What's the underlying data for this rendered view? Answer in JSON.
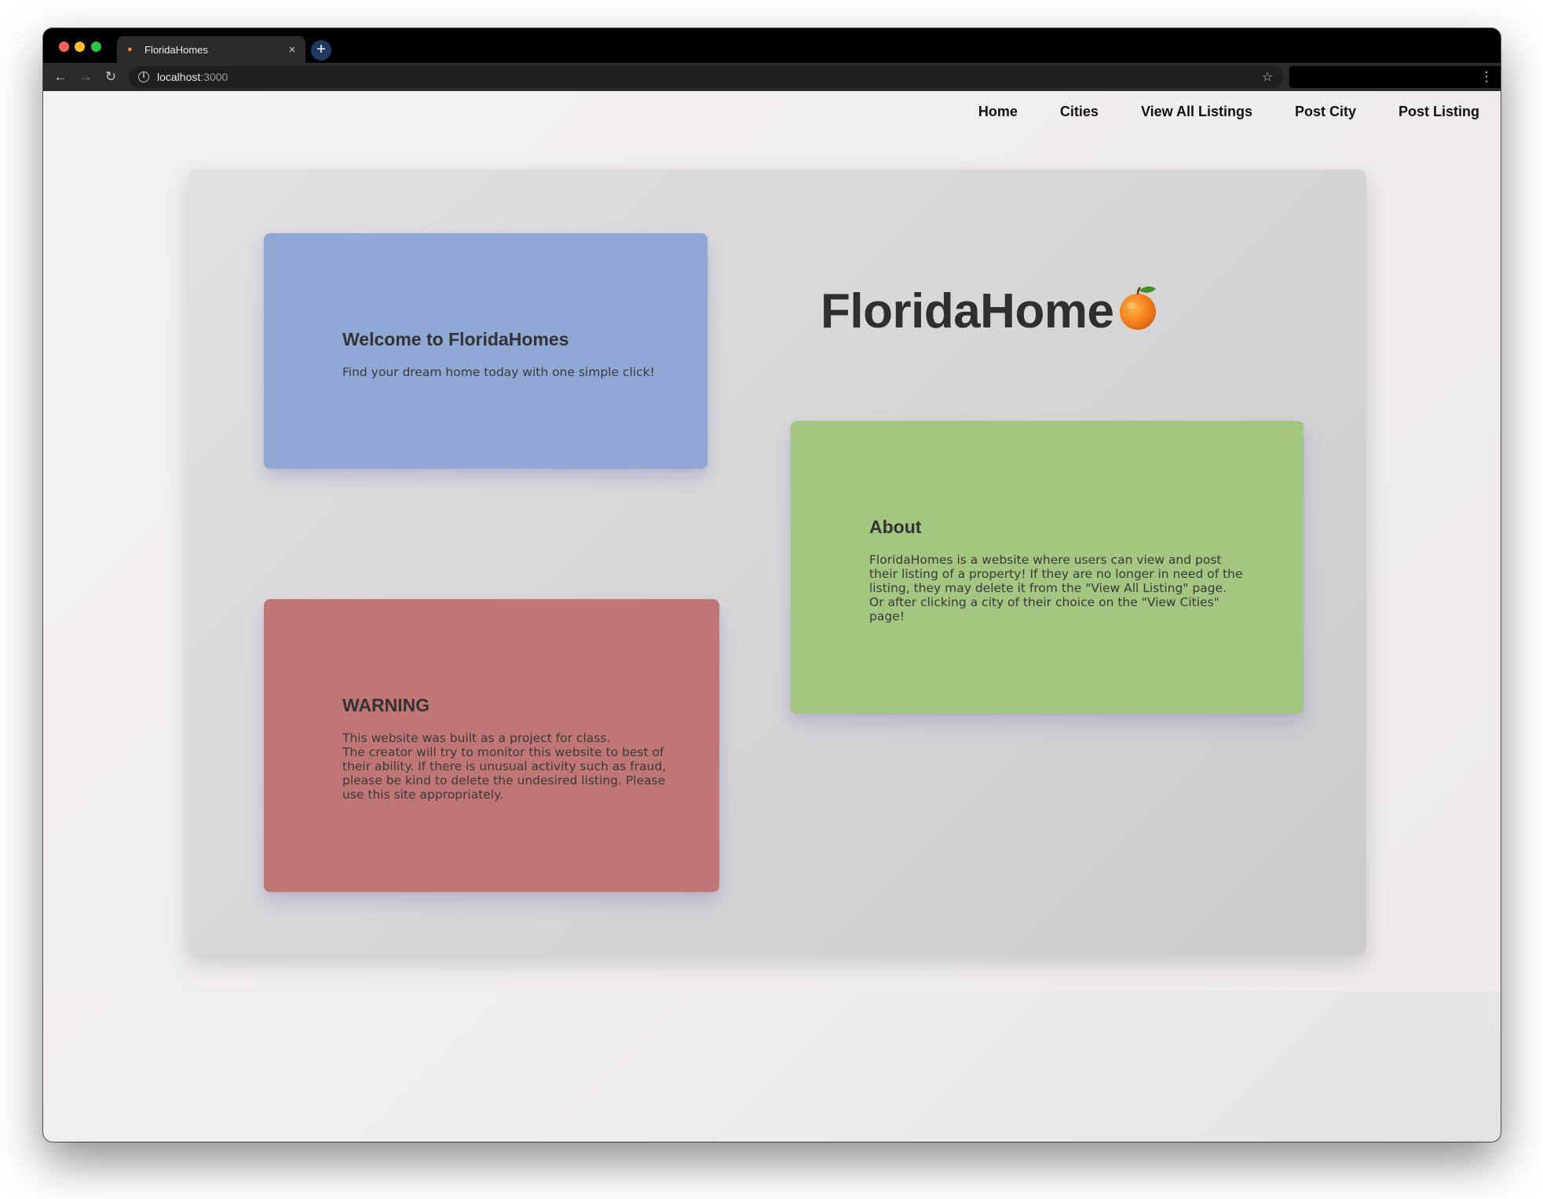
{
  "browser": {
    "tab_title": "FloridaHomes",
    "url_host": "localhost",
    "url_port": ":3000"
  },
  "nav": {
    "items": [
      {
        "label": "Home"
      },
      {
        "label": "Cities"
      },
      {
        "label": "View All Listings"
      },
      {
        "label": "Post City"
      },
      {
        "label": "Post Listing"
      }
    ]
  },
  "logo": {
    "text": "FloridaHome",
    "icon": "orange-emoji"
  },
  "welcome": {
    "title": "Welcome to FloridaHomes",
    "body": "Find your dream home today with one simple click!"
  },
  "about": {
    "title": "About",
    "body": "FloridaHomes is a website where users can view and post their listing of a property! If they are no longer in need of the listing, they may delete it from the \"View All Listing\" page.\nOr after clicking a city of their choice on the \"View Cities\" page!"
  },
  "warning": {
    "title": "WARNING",
    "body": "This website was built as a project for class.\nThe creator will try to monitor this website to best of their ability. If there is unusual activity such as fraud, please be kind to delete the undesired listing. Please use this site appropriately."
  },
  "colors": {
    "welcome_card": "#8fa8d5",
    "about_card": "#a3c681",
    "warning_card": "#c07675"
  }
}
